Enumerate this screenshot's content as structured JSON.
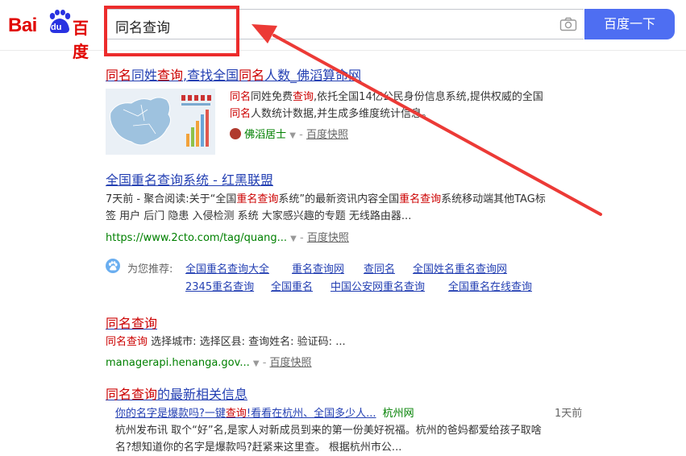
{
  "header": {
    "logo_bai": "Bai",
    "logo_du": "du",
    "logo_cn": "百度",
    "query": "同名查询",
    "search_button": "百度一下"
  },
  "results": [
    {
      "title_parts": [
        "同名",
        "同姓",
        "查询",
        ",查找全国",
        "同名",
        "人数_佛滔算命网"
      ],
      "snippet_line1_parts": [
        "同名",
        "同姓免费",
        "查询",
        ",依托全国14亿公民身份信息系统,提供权威的全国"
      ],
      "snippet_line2_parts": [
        "同名",
        "人数统计数据,并生成多维度统计信息。"
      ],
      "source": "佛滔居士",
      "snapshot": "百度快照"
    },
    {
      "title": "全国重名查询系统 - 红黑联盟",
      "snippet_line1_parts": [
        "7天前 - 聚合阅读:关于“全国",
        "重名查询",
        "系统”的最新资讯内容全国",
        "重名查询",
        "系统移动端其他TAG标"
      ],
      "snippet_line2": "签 用户 后门 隐患 入侵检测 系统   大家感兴趣的专题 无线路由器...",
      "url": "https://www.2cto.com/tag/quang...",
      "snapshot": "百度快照"
    }
  ],
  "recommend": {
    "label": "为您推荐:",
    "row1": [
      "全国重名查询大全",
      "重名查询网",
      "查同名",
      "全国姓名重名查询网"
    ],
    "row2": [
      "2345重名查询",
      "全国重名",
      "中国公安网重名查询",
      "全国重名在线查询"
    ]
  },
  "result3": {
    "title": "同名查询",
    "snippet_parts": [
      "同名查询",
      " 选择城市: 选择区县: 查询姓名: 验证码: ..."
    ],
    "url": "managerapi.henanga.gov...",
    "snapshot": "百度快照"
  },
  "news": {
    "title_parts": [
      "同名查询",
      "的最新相关信息"
    ],
    "item_title_parts": [
      "你的名字是爆款吗?一键",
      "查询",
      "!看看在杭州、全国多少人..."
    ],
    "item_source": "杭州网",
    "item_date": "1天前",
    "snippet_line1": "杭州发布讯 取个“好”名,是家人对新成员到来的第一份美好祝福。杭州的爸妈都爱给孩子取啥",
    "snippet_line2": "名?想知道你的名字是爆款吗?赶紧来这里查。 根据杭州市公..."
  }
}
